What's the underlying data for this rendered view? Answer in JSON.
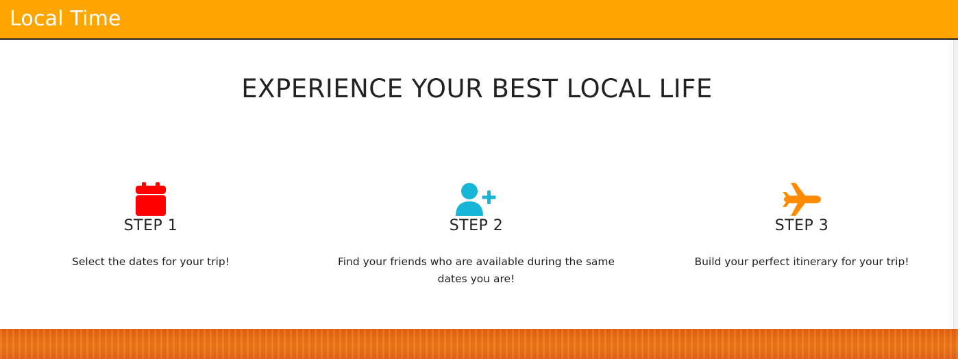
{
  "navbar": {
    "brand": "Local Time",
    "background_color": "#ffa500",
    "text_color": "#ffffff"
  },
  "hero": {
    "headline": "EXPERIENCE YOUR BEST LOCAL LIFE"
  },
  "steps": [
    {
      "icon": "calendar-icon",
      "icon_color": "#ff0000",
      "title": "STEP 1",
      "description": "Select the dates for your trip!"
    },
    {
      "icon": "user-plus-icon",
      "icon_color": "#17b6d6",
      "title": "STEP 2",
      "description": "Find your friends who are available during the same dates you are!"
    },
    {
      "icon": "plane-icon",
      "icon_color": "#ff8c00",
      "title": "STEP 3",
      "description": "Build your perfect itinerary for your trip!"
    }
  ],
  "footer": {
    "band_color": "#ef7417"
  }
}
